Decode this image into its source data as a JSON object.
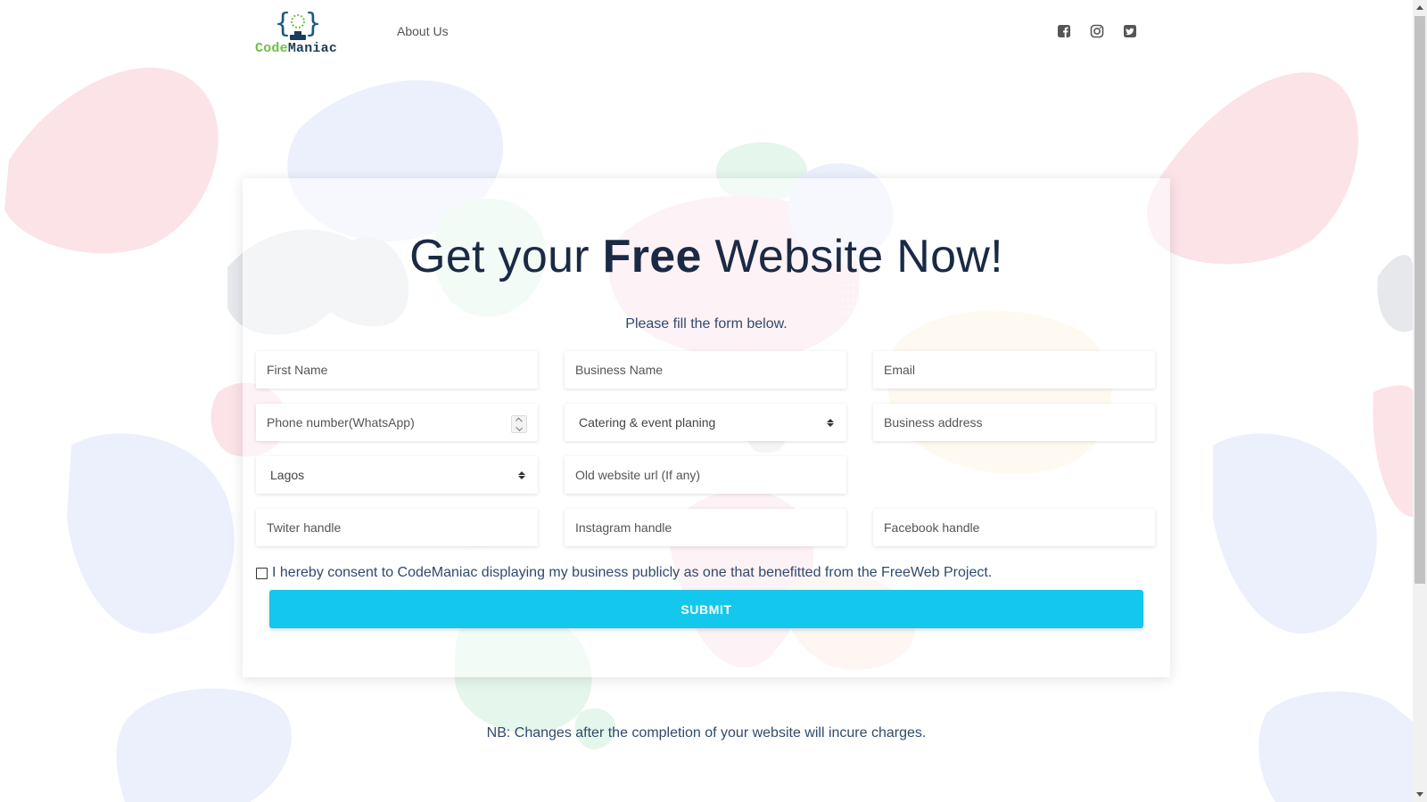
{
  "header": {
    "logo_text_1": "Code",
    "logo_text_2": "Maniac",
    "nav": {
      "about": "About Us"
    },
    "socials": [
      "facebook-icon",
      "instagram-icon",
      "twitter-icon"
    ]
  },
  "form": {
    "title_pre": "Get your ",
    "title_bold": "Free",
    "title_post": " Website Now!",
    "subtitle": "Please fill the form below.",
    "fields": {
      "first_name": "First Name",
      "business_name": "Business Name",
      "email": "Email",
      "phone": "Phone number(WhatsApp)",
      "category": "Catering & event planing",
      "business_address": "Business address",
      "state": "Lagos",
      "old_website": "Old website url (If any)",
      "twitter": "Twiter handle",
      "instagram": "Instagram handle",
      "facebook": "Facebook handle"
    },
    "consent_text": "I hereby consent to CodeManiac displaying my business publicly as one that benefitted from the FreeWeb Project.",
    "consent_checked": false,
    "submit_label": "SUBMIT"
  },
  "footnote": "NB: Changes after the completion of your website will incure charges.",
  "colors": {
    "accent": "#13c8ec",
    "heading": "#1b2a44",
    "text": "#2f4a6e",
    "logo_green": "#6cc04a",
    "logo_navy": "#1c3d5a"
  }
}
